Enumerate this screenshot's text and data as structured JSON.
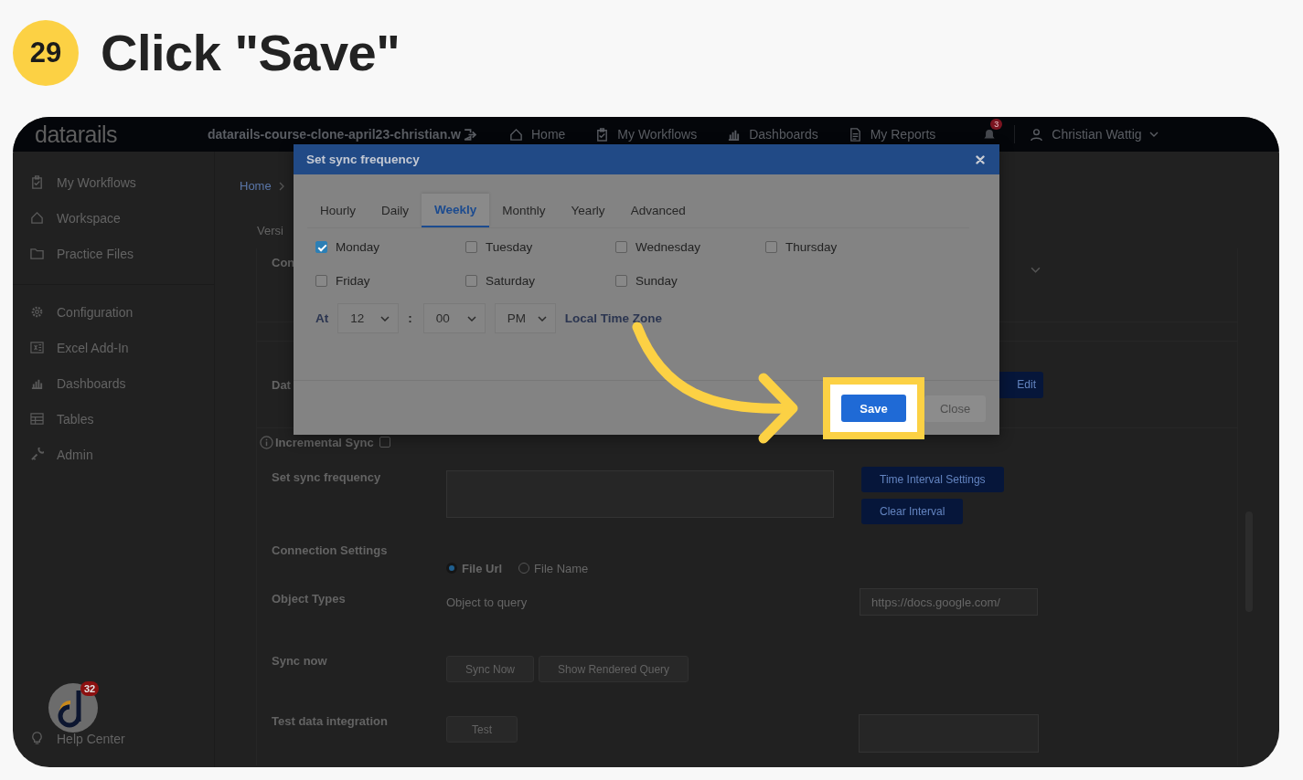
{
  "step": {
    "number": "29",
    "title": "Click \"Save\""
  },
  "topbar": {
    "logo": "datarails",
    "workspace": "datarails-course-clone-april23-christian.w",
    "nav": [
      {
        "label": "Home"
      },
      {
        "label": "My Workflows"
      },
      {
        "label": "Dashboards"
      },
      {
        "label": "My Reports"
      }
    ],
    "notifications": "3",
    "user": "Christian Wattig"
  },
  "sidebar": {
    "groups": [
      [
        {
          "label": "My Workflows"
        },
        {
          "label": "Workspace"
        },
        {
          "label": "Practice Files"
        }
      ],
      [
        {
          "label": "Configuration"
        },
        {
          "label": "Excel Add-In"
        },
        {
          "label": "Dashboards"
        },
        {
          "label": "Tables"
        },
        {
          "label": "Admin"
        }
      ]
    ],
    "help": "Help Center"
  },
  "chat_badge": "32",
  "breadcrumb": "Home",
  "form": {
    "version": "Versi",
    "connection_label": "Con",
    "data_label": "Dat",
    "edit_button": "Edit",
    "incremental": {
      "label": "Incremental Sync",
      "checked": false
    },
    "sync_frequency": {
      "label": "Set sync frequency",
      "buttons": [
        "Time Interval Settings",
        "Clear Interval"
      ]
    },
    "connection_settings": {
      "label": "Connection Settings",
      "options": [
        {
          "label": "File Url",
          "selected": true
        },
        {
          "label": "File Name",
          "selected": false
        }
      ]
    },
    "object_types": {
      "label": "Object Types",
      "placeholder": "Object to query",
      "url": "https://docs.google.com/"
    },
    "sync_now": {
      "label": "Sync now",
      "buttons": [
        "Sync Now",
        "Show Rendered Query"
      ]
    },
    "test": {
      "label": "Test data integration",
      "button": "Test"
    }
  },
  "modal": {
    "title": "Set sync frequency",
    "tabs": [
      {
        "label": "Hourly",
        "selected": false
      },
      {
        "label": "Daily",
        "selected": false
      },
      {
        "label": "Weekly",
        "selected": true
      },
      {
        "label": "Monthly",
        "selected": false
      },
      {
        "label": "Yearly",
        "selected": false
      },
      {
        "label": "Advanced",
        "selected": false
      }
    ],
    "days": [
      {
        "label": "Monday",
        "checked": true
      },
      {
        "label": "Tuesday",
        "checked": false
      },
      {
        "label": "Wednesday",
        "checked": false
      },
      {
        "label": "Thursday",
        "checked": false
      },
      {
        "label": "Friday",
        "checked": false
      },
      {
        "label": "Saturday",
        "checked": false
      },
      {
        "label": "Sunday",
        "checked": false
      }
    ],
    "time": {
      "label": "At",
      "hour": "12",
      "separator": ":",
      "minute": "00",
      "period": "PM",
      "timezone": "Local Time Zone"
    },
    "save": "Save",
    "close": "Close"
  }
}
